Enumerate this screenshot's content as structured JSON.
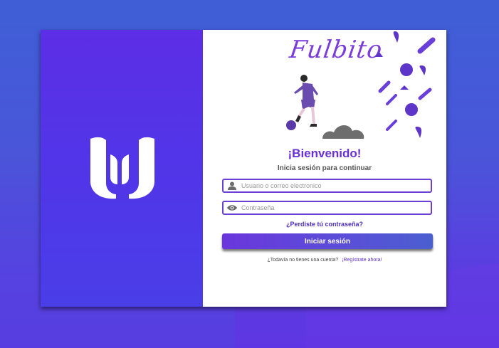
{
  "brand": {
    "name": "Fulbito",
    "accent_color": "#7a3ddb",
    "logo_icon": "brand-logo-icon"
  },
  "login": {
    "heading": "¡Bienvenido!",
    "subtitle": "Inicia sesión para continuar",
    "username_placeholder": "Usuario o correo electronico",
    "username_icon": "user-icon",
    "password_placeholder": "Contraseña",
    "password_icon": "eye-icon",
    "forgot_link": "¿Perdiste tú contraseña?",
    "submit_label": "Iniciar sesión",
    "signup_prompt": "¿Todavía no tienes una cuenta?",
    "signup_link": "¡Regístrate ahora!"
  }
}
